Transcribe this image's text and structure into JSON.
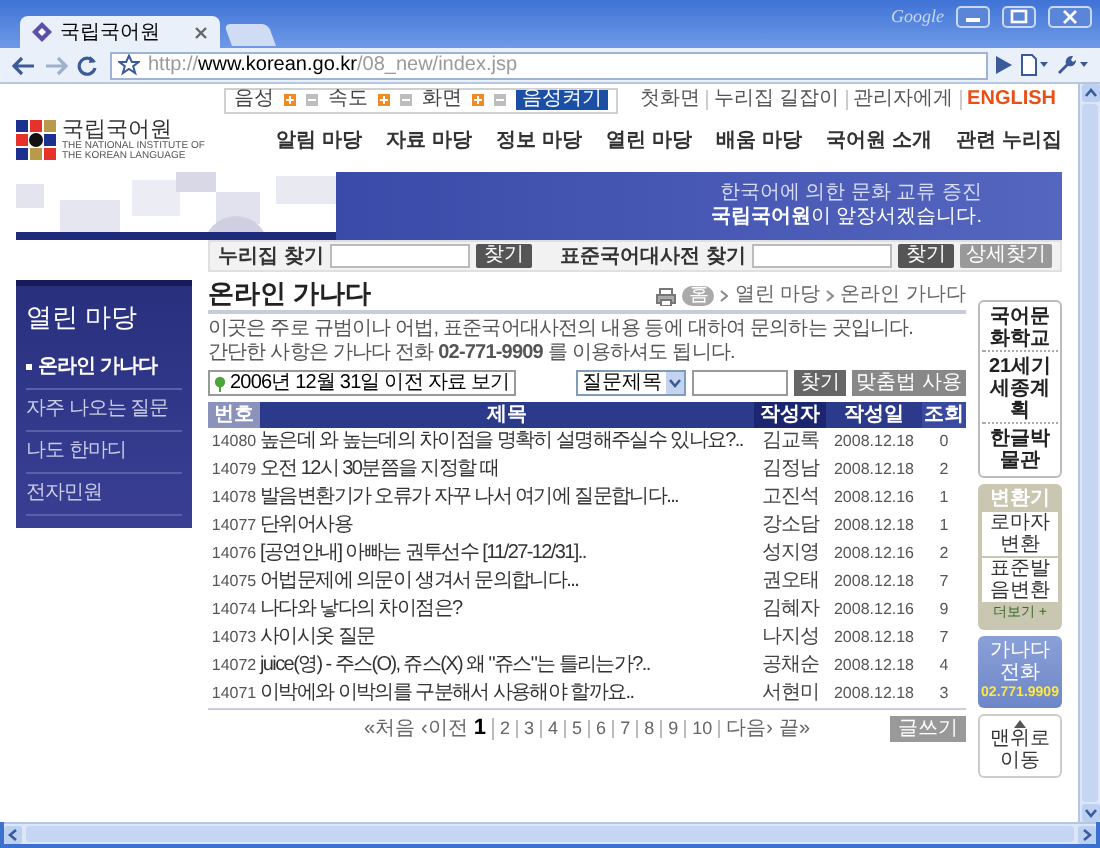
{
  "browser": {
    "tab_title": "국립국어원",
    "brand": "Google",
    "url": {
      "scheme": "http://",
      "host": "www.korean.go.kr",
      "path": "/08_new/index.jsp"
    }
  },
  "utility_bar": {
    "controls": [
      "음성",
      "속도",
      "화면"
    ],
    "voice_button": "음성켜기",
    "links": [
      {
        "label": "첫화면",
        "kind": "link"
      },
      {
        "label": "누리집 길잡이",
        "kind": "link"
      },
      {
        "label": "관리자에게",
        "kind": "link"
      },
      {
        "label": "ENGLISH",
        "kind": "language"
      }
    ]
  },
  "logo": {
    "name": "국립국어원",
    "subtitle": [
      "THE NATIONAL INSTITUTE OF",
      "THE KOREAN LANGUAGE"
    ]
  },
  "nav": [
    "알림 마당",
    "자료 마당",
    "정보 마당",
    "열린 마당",
    "배움 마당",
    "국어원 소개",
    "관련 누리집"
  ],
  "banner": {
    "line1": "한국어에 의한 문화 교류 증진",
    "line2": "**국립국어원**이 앞장서겠습니다."
  },
  "site_search": {
    "label": "누리집 찾기",
    "button": "찾기"
  },
  "dictionary_search": {
    "label": "표준국어대사전 찾기",
    "buttons": [
      "찾기",
      "상세찾기"
    ]
  },
  "sidebar": {
    "title": "열린 마당",
    "items": [
      {
        "label": "온라인 가나다",
        "selected": true
      },
      {
        "label": "자주 나오는 질문",
        "selected": false
      },
      {
        "label": "나도 한마디",
        "selected": false
      },
      {
        "label": "전자민원",
        "selected": false
      }
    ]
  },
  "page": {
    "title": "온라인 가나다",
    "breadcrumb": [
      "홈",
      "열린 마당",
      "온라인 가나다"
    ],
    "description": [
      "이곳은 주로 규범이나 어법, 표준국어대사전의 내용 등에 대하여 문의하는 곳입니다.",
      "간단한 사항은 가나다 전화 **02-771-9909** 를 이용하셔도 됩니다."
    ],
    "archive_button": "2006년 12월 31일 이전 자료 보기",
    "search_field": "질문제목",
    "search_buttons": [
      "찾기",
      "맞춤법 사용"
    ]
  },
  "table": {
    "columns": [
      "번호",
      "제목",
      "작성자",
      "작성일",
      "조회"
    ],
    "rows": [
      {
        "number": "14080",
        "title": "높은데 와 높는데의 차이점을 명확히 설명해주실수 있나요?..",
        "author": "김교록",
        "date": "2008.12.18",
        "views": "0"
      },
      {
        "number": "14079",
        "title": "오전 12시 30분쯤을 지정할 때",
        "author": "김정남",
        "date": "2008.12.18",
        "views": "2"
      },
      {
        "number": "14078",
        "title": "발음변환기가 오류가 자꾸 나서 여기에 질문합니다...",
        "author": "고진석",
        "date": "2008.12.16",
        "views": "1"
      },
      {
        "number": "14077",
        "title": "단위어사용",
        "author": "강소담",
        "date": "2008.12.18",
        "views": "1"
      },
      {
        "number": "14076",
        "title": "[공연안내] 아빠는 권투선수 [11/27-12/31]..",
        "author": "성지영",
        "date": "2008.12.16",
        "views": "2"
      },
      {
        "number": "14075",
        "title": "어법문제에 의문이 생겨서 문의합니다...",
        "author": "권오태",
        "date": "2008.12.18",
        "views": "7"
      },
      {
        "number": "14074",
        "title": "나다와 낳다의 차이점은?",
        "author": "김혜자",
        "date": "2008.12.16",
        "views": "9"
      },
      {
        "number": "14073",
        "title": "사이시옷 질문",
        "author": "나지성",
        "date": "2008.12.18",
        "views": "7"
      },
      {
        "number": "14072",
        "title": "juice(영) - 주스(O), 쥬스(X) 왜 \"쥬스\"는 틀리는가?..",
        "author": "공채순",
        "date": "2008.12.18",
        "views": "4"
      },
      {
        "number": "14071",
        "title": "이박에와 이박의를 구분해서 사용해야 할까요..",
        "author": "서현미",
        "date": "2008.12.18",
        "views": "3"
      }
    ]
  },
  "pagination": {
    "first": "«처음",
    "prev": "‹이전",
    "pages": [
      {
        "label": "1",
        "selected": true
      },
      {
        "label": "2",
        "selected": false
      },
      {
        "label": "3",
        "selected": false
      },
      {
        "label": "4",
        "selected": false
      },
      {
        "label": "5",
        "selected": false
      },
      {
        "label": "6",
        "selected": false
      },
      {
        "label": "7",
        "selected": false
      },
      {
        "label": "8",
        "selected": false
      },
      {
        "label": "9",
        "selected": false
      },
      {
        "label": "10",
        "selected": false
      }
    ],
    "next": "다음›",
    "last": "끝»"
  },
  "write_button": "글쓰기",
  "right_panel": {
    "links": [
      "국어문화학교",
      "21세기 세종계획",
      "한글박물관"
    ],
    "converter": {
      "title": "변환기",
      "items": [
        "로마자변환",
        "표준발음변환"
      ],
      "more": "더보기 +"
    },
    "phone": {
      "label": "가나다 전화",
      "number": "02.771.9909"
    },
    "top_link": "맨위로 이동"
  }
}
